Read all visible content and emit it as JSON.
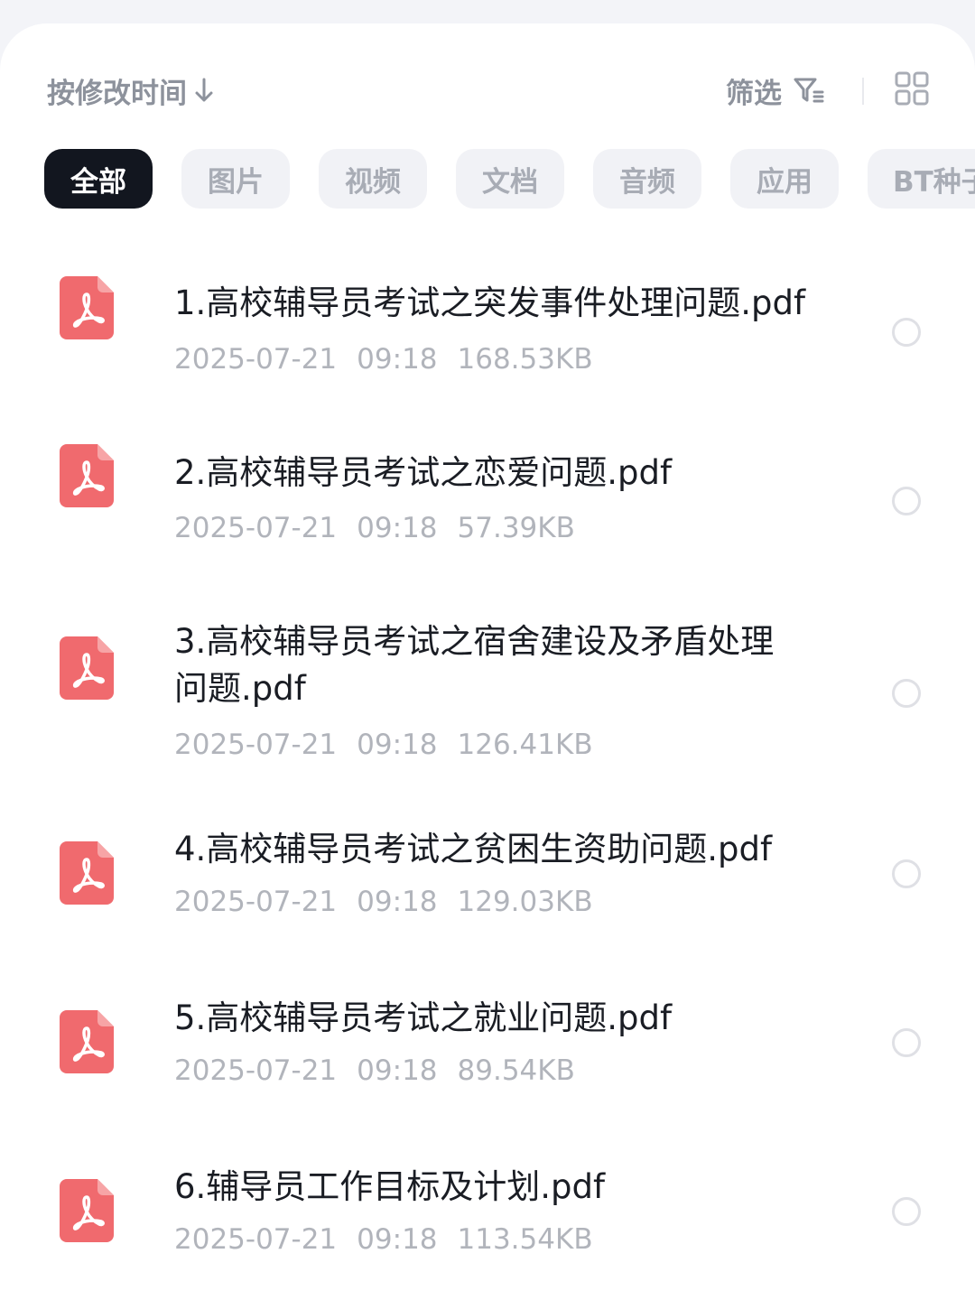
{
  "toolbar": {
    "sort_label": "按修改时间",
    "filter_label": "筛选"
  },
  "tabs": [
    {
      "label": "全部",
      "active": true
    },
    {
      "label": "图片",
      "active": false
    },
    {
      "label": "视频",
      "active": false
    },
    {
      "label": "文档",
      "active": false
    },
    {
      "label": "音频",
      "active": false
    },
    {
      "label": "应用",
      "active": false
    },
    {
      "label": "BT种子",
      "active": false
    }
  ],
  "files": [
    {
      "name": "1.高校辅导员考试之突发事件处理问题.pdf",
      "date": "2025-07-21",
      "time": "09:18",
      "size": "168.53KB",
      "icon": "pdf-icon"
    },
    {
      "name": "2.高校辅导员考试之恋爱问题.pdf",
      "date": "2025-07-21",
      "time": "09:18",
      "size": "57.39KB",
      "icon": "pdf-icon"
    },
    {
      "name": "3.高校辅导员考试之宿舍建设及矛盾处理问题.pdf",
      "date": "2025-07-21",
      "time": "09:18",
      "size": "126.41KB",
      "icon": "pdf-icon"
    },
    {
      "name": "4.高校辅导员考试之贫困生资助问题.pdf",
      "date": "2025-07-21",
      "time": "09:18",
      "size": "129.03KB",
      "icon": "pdf-icon"
    },
    {
      "name": "5.高校辅导员考试之就业问题.pdf",
      "date": "2025-07-21",
      "time": "09:18",
      "size": "89.54KB",
      "icon": "pdf-icon"
    },
    {
      "name": "6.辅导员工作目标及计划.pdf",
      "date": "2025-07-21",
      "time": "09:18",
      "size": "113.54KB",
      "icon": "pdf-icon"
    }
  ],
  "colors": {
    "accent_dark": "#12161f",
    "pdf_red": "#f06a6e",
    "muted_text": "#b1b4bb"
  }
}
